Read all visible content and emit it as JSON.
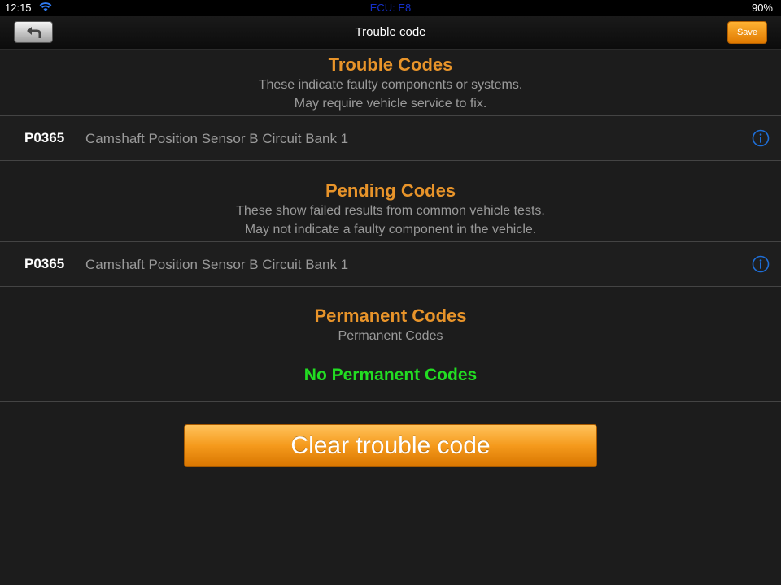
{
  "status_bar": {
    "time": "12:15",
    "ecu": "ECU: E8",
    "battery": "90%",
    "wifi_icon": "wifi-icon"
  },
  "navbar": {
    "title": "Trouble code",
    "back_icon": "back-arrow-icon",
    "save_label": "Save"
  },
  "sections": {
    "trouble": {
      "title": "Trouble Codes",
      "description_lines": [
        "These indicate faulty components or systems.",
        "May require vehicle service to fix."
      ],
      "codes": [
        {
          "code": "P0365",
          "description": "Camshaft Position Sensor B Circuit Bank 1",
          "icon": "info-icon"
        }
      ]
    },
    "pending": {
      "title": "Pending Codes",
      "description_lines": [
        "These show failed results from common vehicle tests.",
        "May not indicate a faulty component in the vehicle."
      ],
      "codes": [
        {
          "code": "P0365",
          "description": "Camshaft Position Sensor B Circuit Bank 1",
          "icon": "info-icon"
        }
      ]
    },
    "permanent": {
      "title": "Permanent Codes",
      "description_lines": [
        "Permanent Codes"
      ],
      "empty_message": "No Permanent Codes"
    }
  },
  "clear_button_label": "Clear trouble code",
  "colors": {
    "background": "#1c1c1c",
    "section_title": "#e8942a",
    "description": "#9a9a9a",
    "no_codes": "#22dd22",
    "accent_orange": "#f59a1c",
    "info_blue": "#1e6fd9",
    "ecu_text": "#1530c8"
  }
}
